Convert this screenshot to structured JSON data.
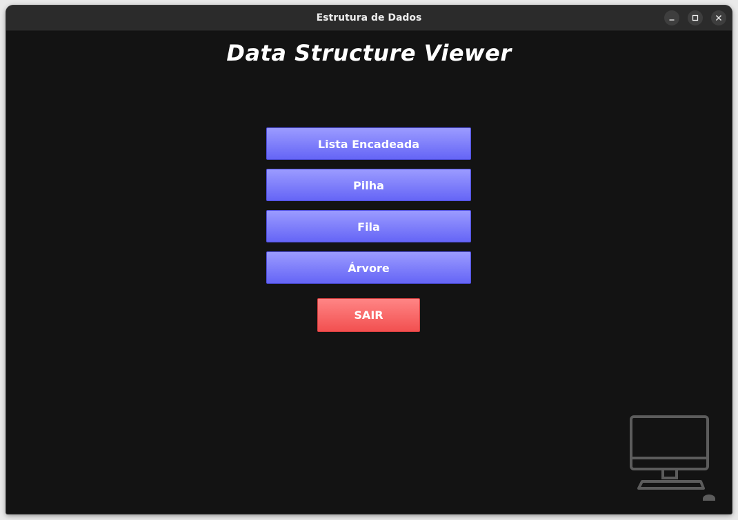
{
  "window": {
    "title": "Estrutura de Dados",
    "controls": [
      "minimize-icon",
      "maximize-icon",
      "close-icon"
    ]
  },
  "app": {
    "title": "Data Structure Viewer"
  },
  "menu": {
    "buttons": [
      {
        "label": "Lista Encadeada"
      },
      {
        "label": "Pilha"
      },
      {
        "label": "Fila"
      },
      {
        "label": "Árvore"
      }
    ],
    "exit_label": "SAIR"
  },
  "decoration": {
    "icon": "desktop-computer-icon"
  },
  "colors": {
    "background": "#131313",
    "titlebar": "#2b2b2b",
    "menu_button": "#7f7ffb",
    "exit_button": "#f86a6a",
    "icon": "#5c5c5c"
  }
}
